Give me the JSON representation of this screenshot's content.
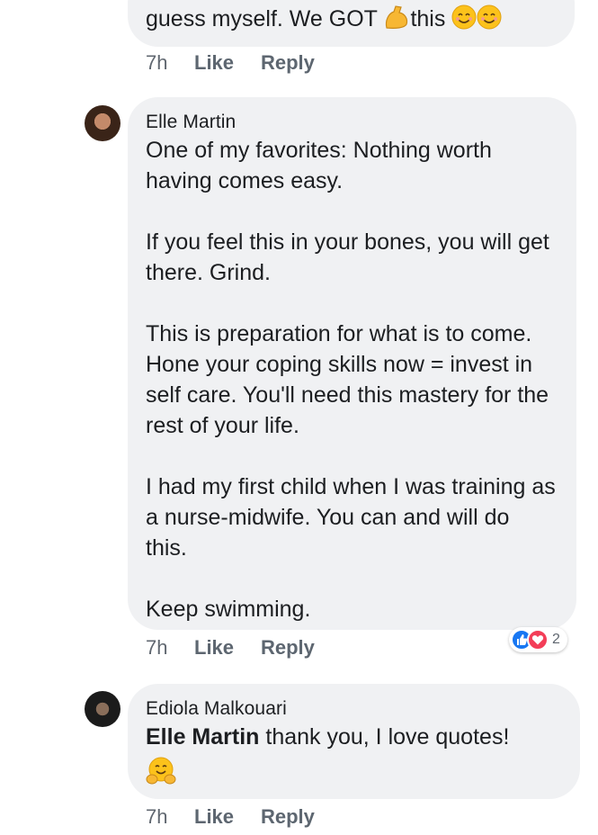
{
  "top_comment": {
    "text": "guess myself. We GOT",
    "text_after": "this",
    "icons": [
      "flexed-biceps-icon",
      "smiling-face-icon",
      "smiling-face-icon"
    ],
    "time": "7h",
    "like_label": "Like",
    "reply_label": "Reply"
  },
  "comment_elle": {
    "author": "Elle Martin",
    "body": "One of my favorites: Nothing worth having comes easy.\n\nIf you feel this in your bones, you will get there. Grind.\n\nThis is preparation for what is to come. Hone your coping skills now = invest in self care. You'll need this mastery for the rest of your life.\n\nI had my first child when I was training as a nurse-midwife. You can and will do this.\n\nKeep swimming.",
    "time": "7h",
    "like_label": "Like",
    "reply_label": "Reply",
    "reactions": {
      "icons": [
        "like-reaction-icon",
        "love-reaction-icon"
      ],
      "count": "2",
      "colors": {
        "like": "#1877f2",
        "love": "#f33e58"
      }
    }
  },
  "comment_ediola": {
    "author": "Ediola Malkouari",
    "mention": "Elle Martin",
    "text": "thank you, I love quotes!",
    "icon": "hugging-face-icon",
    "time": "7h",
    "like_label": "Like",
    "reply_label": "Reply"
  },
  "colors": {
    "bubble_bg": "#f0f1f3",
    "text": "#1c1e21",
    "meta_text": "#606770"
  }
}
